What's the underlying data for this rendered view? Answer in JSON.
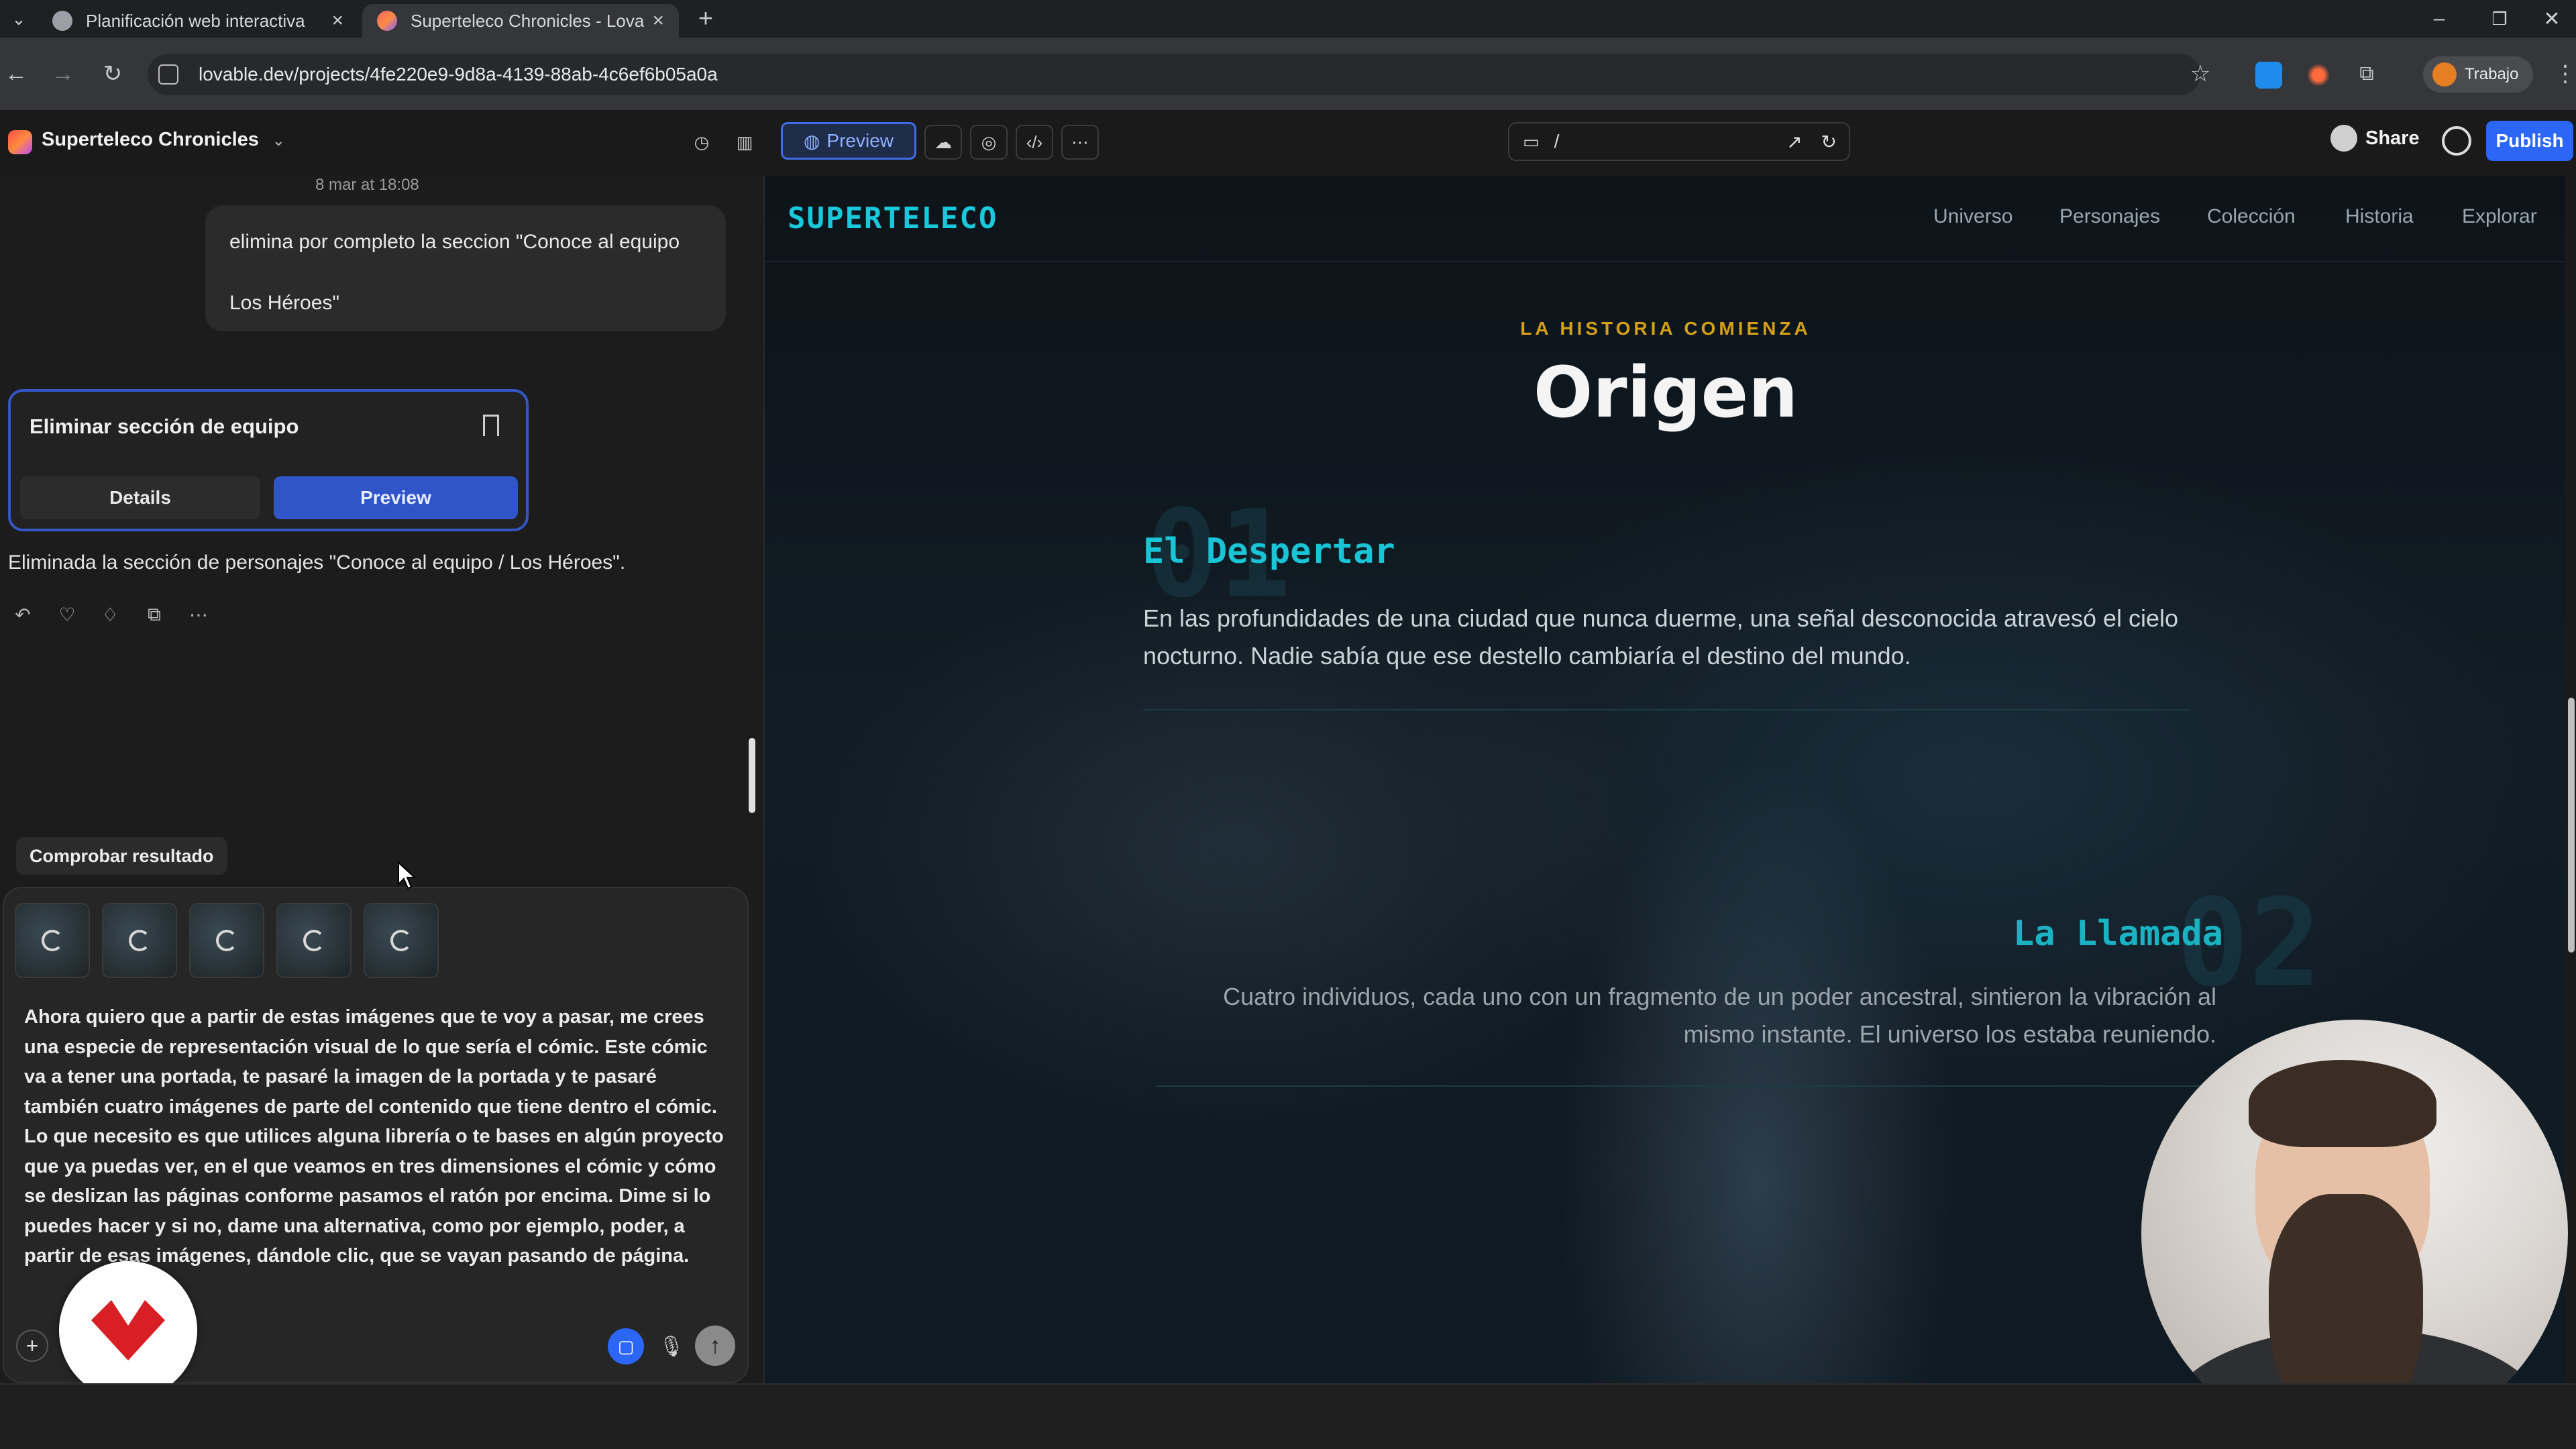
{
  "browser": {
    "tabs": [
      {
        "title": "Planificación web interactiva",
        "active": false
      },
      {
        "title": "Superteleco Chronicles - Lovable",
        "active": true
      }
    ],
    "url": "lovable.dev/projects/4fe220e9-9d8a-4139-88ab-4c6ef6b05a0a",
    "profile_label": "Trabajo"
  },
  "app": {
    "project_name": "Superteleco Chronicles",
    "preview_label": "Preview",
    "path": "/",
    "share_label": "Share",
    "publish_label": "Publish",
    "accent_color": "#2b66f6"
  },
  "chat": {
    "date": "8 mar at 18:08",
    "user_message_lines": [
      "elimina por completo la seccion \"Conoce al equipo",
      "Los Héroes\""
    ],
    "action_card": {
      "title": "Eliminar sección de equipo",
      "details_label": "Details",
      "preview_label": "Preview"
    },
    "ai_response": "Eliminada la sección de personajes \"Conoce al equipo / Los Héroes\".",
    "check_chip": "Comprobar resultado",
    "prompt": "Ahora quiero que a partir de estas imágenes que te voy a pasar, me crees una especie de representación visual de lo que sería el cómic. Este cómic va a tener una portada, te pasaré la imagen de la portada y te pasaré también cuatro imágenes de parte del contenido que tiene dentro el cómic. Lo que necesito es que utilices alguna librería o te bases en algún proyecto que ya puedas ver, en el que veamos en tres dimensiones el cómic y cómo se deslizan las páginas conforme pasamos el ratón por encima. Dime si lo puedes hacer y si no, dame una alternativa, como por ejemplo, poder, a partir de esas imágenes, dándole clic, que se vayan pasando de página."
  },
  "site": {
    "logo": "SUPERTELECO",
    "logo_color": "#18c9dc",
    "nav": [
      "Universo",
      "Personajes",
      "Colección",
      "Historia",
      "Explorar"
    ],
    "eyebrow": "LA HISTORIA COMIENZA",
    "eyebrow_color": "#d4a017",
    "title": "Origen",
    "chapters": [
      {
        "number": "01",
        "title": "El Despertar",
        "text": "En las profundidades de una ciudad que nunca duerme, una señal desconocida atravesó el cielo nocturno. Nadie sabía que ese destello cambiaría el destino del mundo."
      },
      {
        "number": "02",
        "title": "La Llamada",
        "text": "Cuatro individuos, cada uno con un fragmento de un poder ancestral, sintieron la vibración al mismo instante. El universo los estaba reuniendo."
      }
    ]
  }
}
